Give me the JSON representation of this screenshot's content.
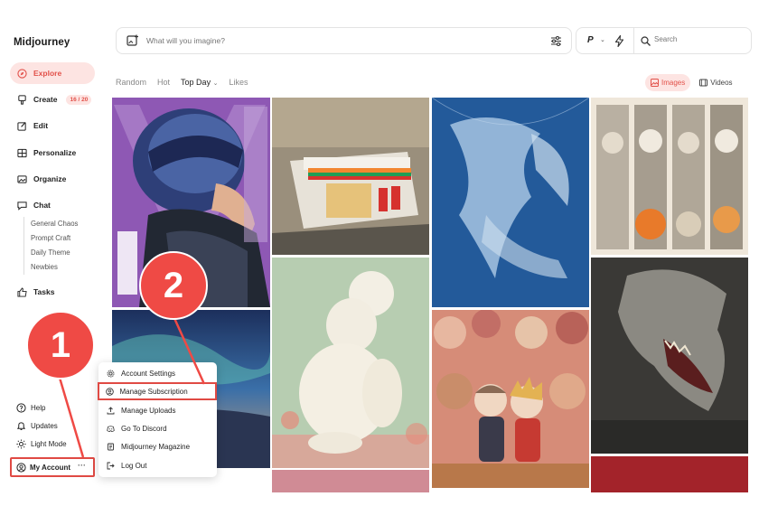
{
  "app": {
    "logo": "Midjourney"
  },
  "sidebar": {
    "items": [
      {
        "label": "Explore",
        "icon": "compass-icon",
        "active": true
      },
      {
        "label": "Create",
        "icon": "brush-icon",
        "badge": "16 / 20"
      },
      {
        "label": "Edit",
        "icon": "edit-icon"
      },
      {
        "label": "Personalize",
        "icon": "personalize-icon"
      },
      {
        "label": "Organize",
        "icon": "image-folder-icon"
      },
      {
        "label": "Chat",
        "icon": "chat-icon"
      },
      {
        "label": "Tasks",
        "icon": "thumbs-up-icon"
      }
    ],
    "chat_rooms": [
      "General Chaos",
      "Prompt Craft",
      "Daily Theme",
      "Newbies"
    ],
    "bottom": [
      {
        "label": "Help",
        "icon": "help-icon"
      },
      {
        "label": "Updates",
        "icon": "bell-icon"
      },
      {
        "label": "Light Mode",
        "icon": "sun-icon"
      }
    ],
    "account": {
      "label": "My Account",
      "more": "···"
    }
  },
  "prompt": {
    "placeholder": "What will you imagine?"
  },
  "tools": {
    "mode": "P",
    "search_placeholder": "Search"
  },
  "feed_tabs": [
    "Random",
    "Hot",
    "Top Day",
    "Likes"
  ],
  "feed_tab_selected": "Top Day",
  "type_tabs": [
    {
      "label": "Images",
      "active": true
    },
    {
      "label": "Videos",
      "active": false
    }
  ],
  "account_menu": [
    {
      "label": "Account Settings",
      "icon": "gear-icon"
    },
    {
      "label": "Manage Subscription",
      "icon": "user-circle-icon",
      "highlighted": true
    },
    {
      "label": "Manage Uploads",
      "icon": "upload-icon"
    },
    {
      "label": "Go To Discord",
      "icon": "discord-icon"
    },
    {
      "label": "Midjourney Magazine",
      "icon": "magazine-icon"
    },
    {
      "label": "Log Out",
      "icon": "logout-icon"
    }
  ],
  "annotations": {
    "step1": "1",
    "step2": "2"
  },
  "colors": {
    "accent": "#e2514a",
    "accent_bg": "#fde4e2",
    "marker": "#ef4a45"
  }
}
